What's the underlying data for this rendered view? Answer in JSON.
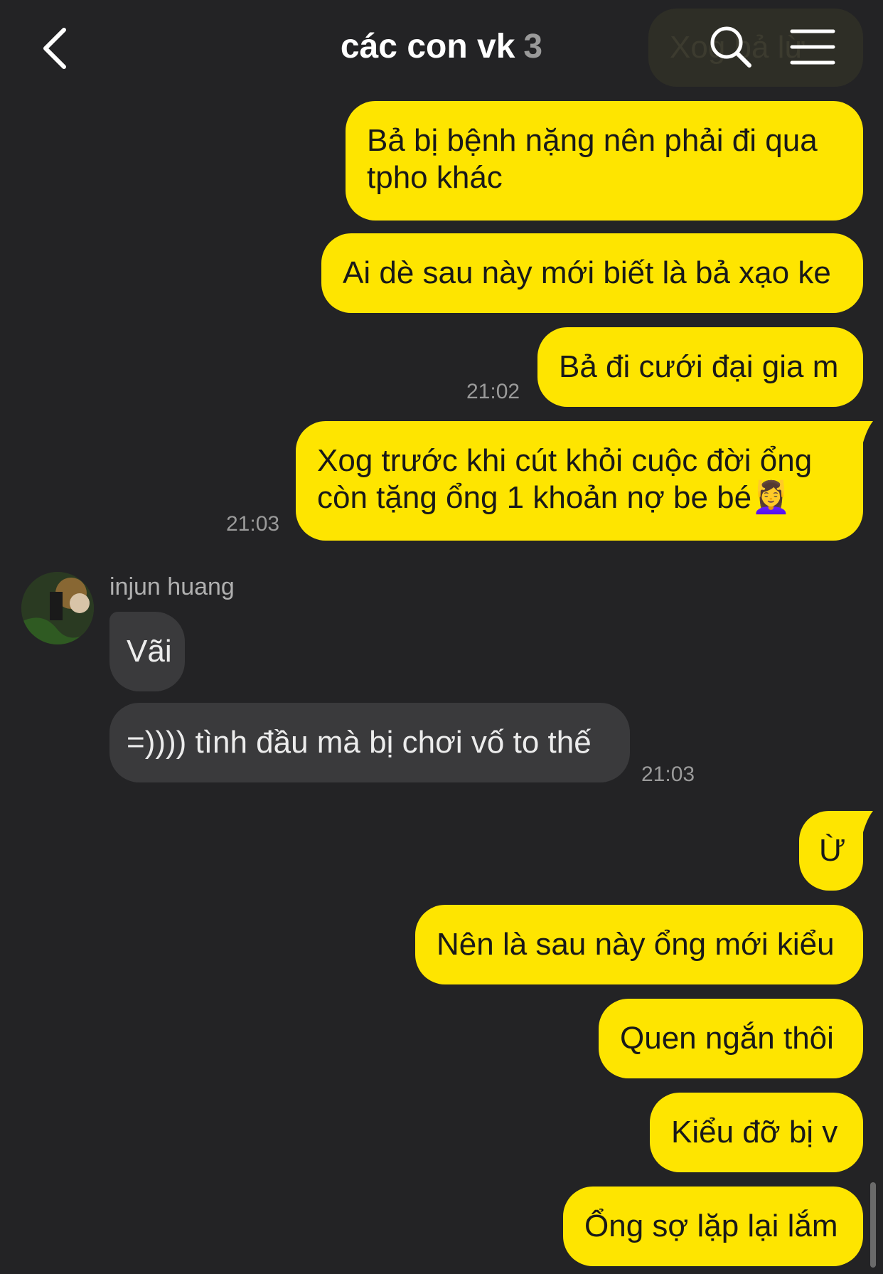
{
  "header": {
    "title": "các con vk",
    "member_count": "3",
    "ghost_text": "Xog bả lừ"
  },
  "messages": {
    "m1": "Bả bị bệnh nặng nên phải đi qua tpho khác",
    "m2": "Ai dè sau này mới biết là bả xạo ke",
    "m3": "Bả đi cưới đại gia m",
    "m3_time": "21:02",
    "m4": "Xog trước khi cút khỏi cuộc đời ổng còn tặng ổng 1 khoản nợ be bé💆‍♀️",
    "m4_time": "21:03",
    "sender_name": "injun huang",
    "r1": "Vãi",
    "r2": "=)))) tình đầu mà bị chơi vố to thế",
    "r2_time": "21:03",
    "m5": "Ừ",
    "m6": "Nên là sau này ổng mới kiểu",
    "m7": "Quen ngắn thôi",
    "m8": "Kiểu đỡ bị v",
    "m9": "Ổng sợ lặp lại lắm"
  },
  "colors": {
    "background": "#232325",
    "sent_bubble": "#fee500",
    "received_bubble": "#3a3a3c"
  },
  "icons": [
    "back-arrow-icon",
    "search-icon",
    "menu-icon"
  ]
}
